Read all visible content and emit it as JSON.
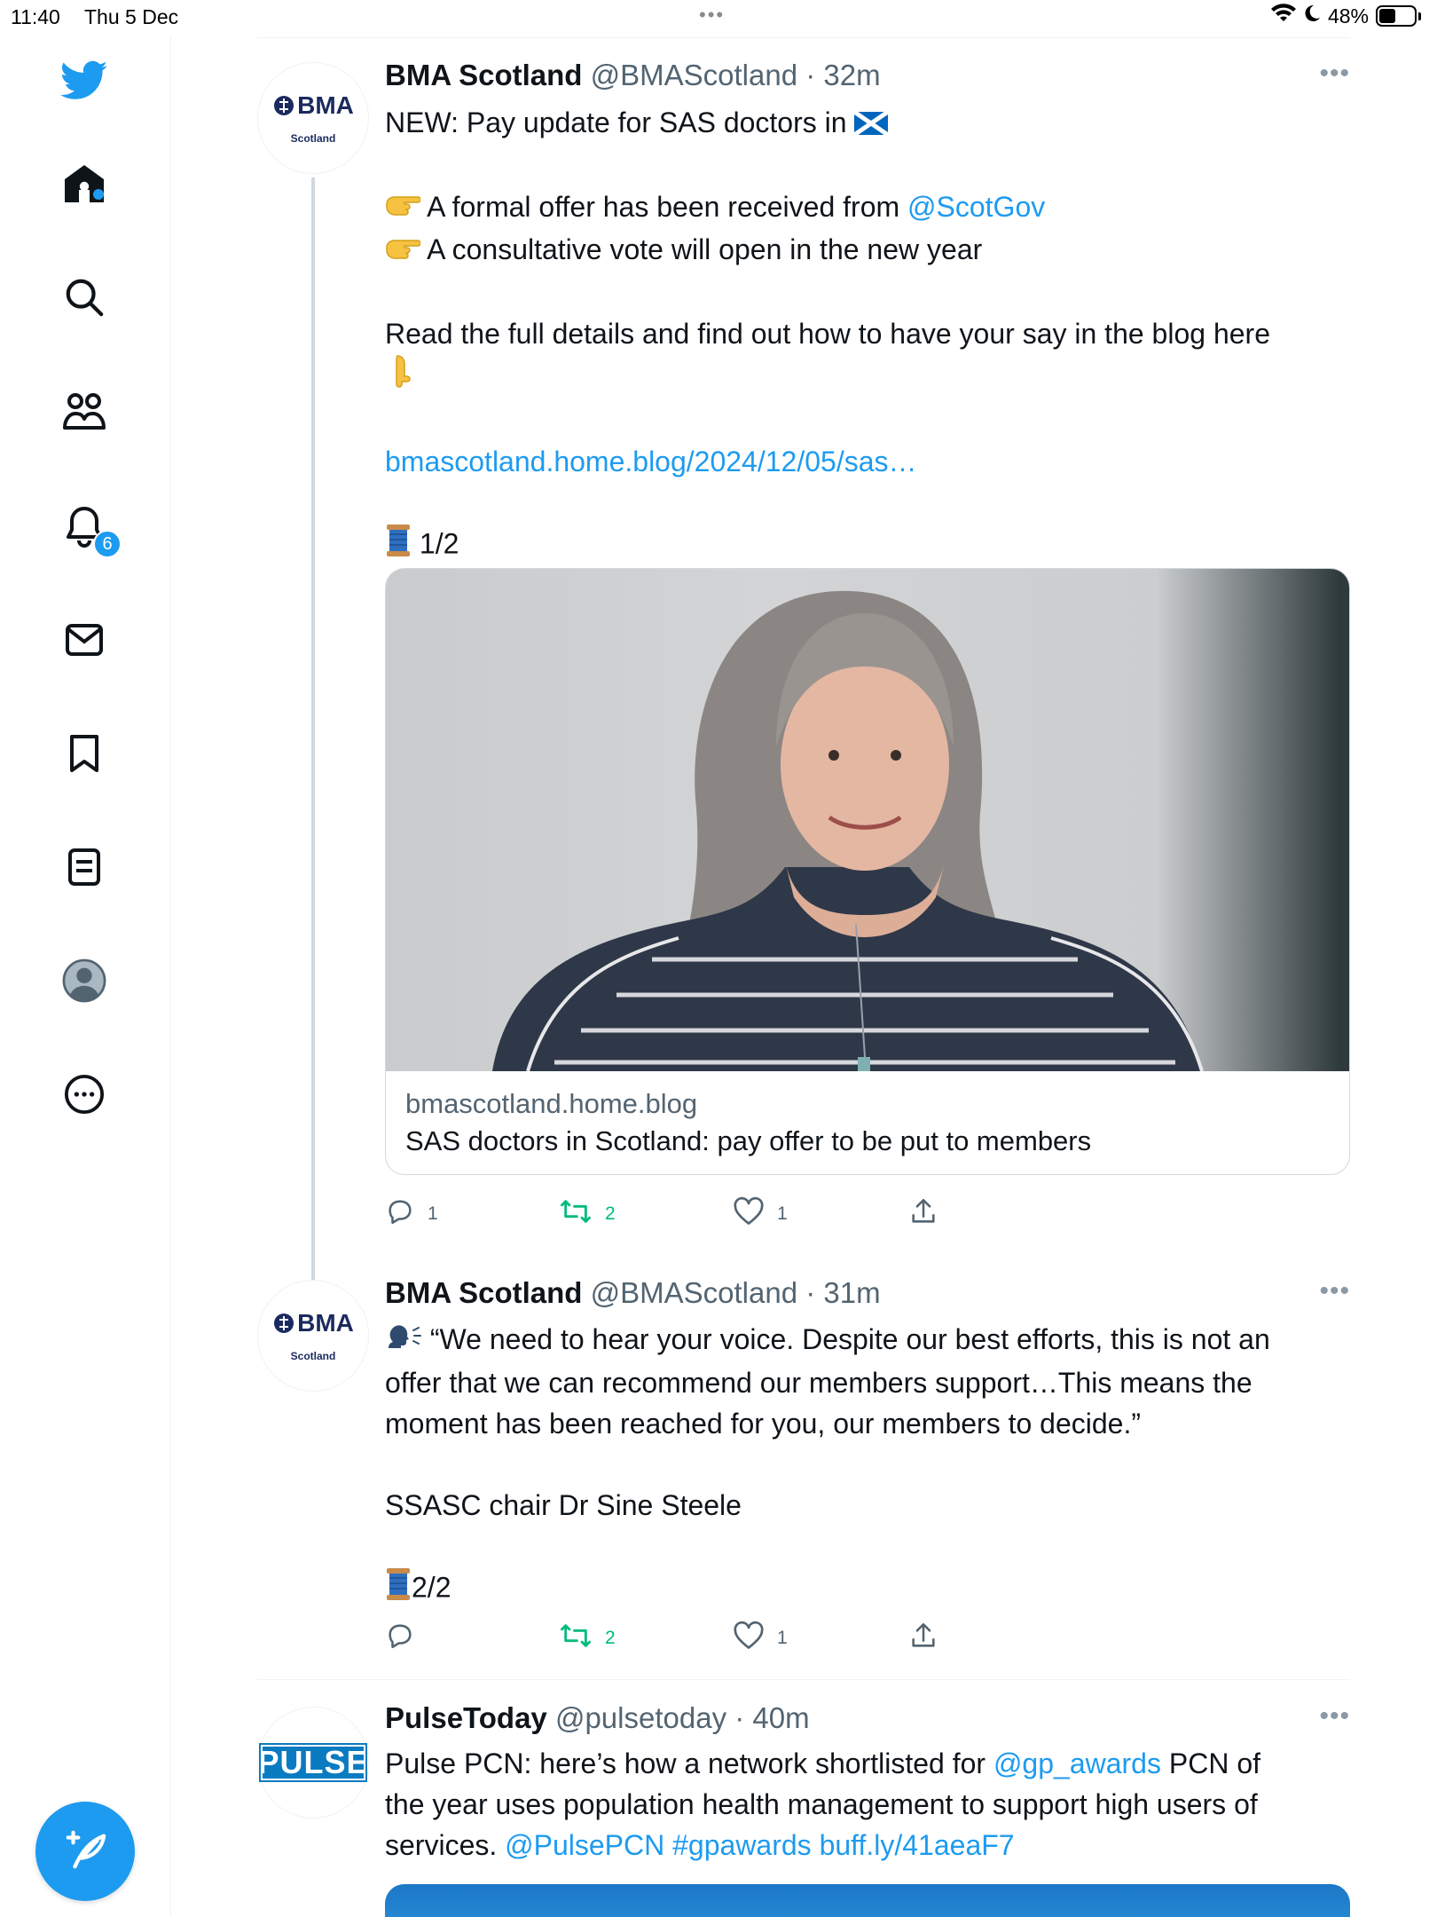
{
  "status_bar": {
    "time": "11:40",
    "date": "Thu 5 Dec",
    "battery": "48%",
    "battery_level": 0.48
  },
  "sidebar": {
    "items": [
      {
        "icon": "home-icon",
        "has_dot": true
      },
      {
        "icon": "search-icon"
      },
      {
        "icon": "communities-icon"
      },
      {
        "icon": "notifications-icon",
        "badge": "6"
      },
      {
        "icon": "messages-icon"
      },
      {
        "icon": "bookmarks-icon"
      },
      {
        "icon": "lists-icon"
      },
      {
        "icon": "profile-icon"
      },
      {
        "icon": "more-icon"
      }
    ],
    "compose_icon": "compose-icon",
    "accent": "#1d9bf0"
  },
  "tweets": [
    {
      "avatar_text": "BMA",
      "avatar_sub": "Scotland",
      "name": "BMA Scotland",
      "handle": "@BMAScotland",
      "sep": "·",
      "ago": "32m",
      "lines": {
        "l1": "NEW: Pay update for SAS doctors in ",
        "l2_pre": "A formal offer has been received from ",
        "l2_link": "@ScotGov",
        "l3": "A consultative vote will open in the new year",
        "l4": "Read the full details and find out how to have your say in the blog here",
        "l5_link": "bmascotland.home.blog/2024/12/05/sas…",
        "l6": "1/2"
      },
      "card": {
        "domain": "bmascotland.home.blog",
        "title": "SAS doctors in Scotland: pay offer to be put to members"
      },
      "actions": {
        "replies": "1",
        "retweets": "2",
        "likes": "1"
      }
    },
    {
      "avatar_text": "BMA",
      "avatar_sub": "Scotland",
      "name": "BMA Scotland",
      "handle": "@BMAScotland",
      "sep": "·",
      "ago": "31m",
      "lines": {
        "l1": "“We need to hear your voice. Despite our best efforts, this is not an",
        "l2": "offer that we can recommend our members support…This means the",
        "l3": "moment has been reached for you, our members to decide.”",
        "l4": "SSASC chair Dr Sine Steele",
        "l5": "2/2"
      },
      "actions": {
        "replies": "",
        "retweets": "2",
        "likes": "1"
      }
    },
    {
      "avatar_text": "PULSE",
      "name": "PulseToday",
      "handle": "@pulsetoday",
      "sep": "·",
      "ago": "40m",
      "lines": {
        "l1_pre": "Pulse PCN: here’s how a network shortlisted for ",
        "l1_link": "@gp_awards",
        "l1_post": " PCN of",
        "l2": "the year uses population health management to support high users of",
        "l3_pre": "services. ",
        "l3_link1": "@PulsePCN",
        "l3_link2": "#gpawards",
        "l3_link3": "buff.ly/41aeaF7"
      }
    }
  ]
}
